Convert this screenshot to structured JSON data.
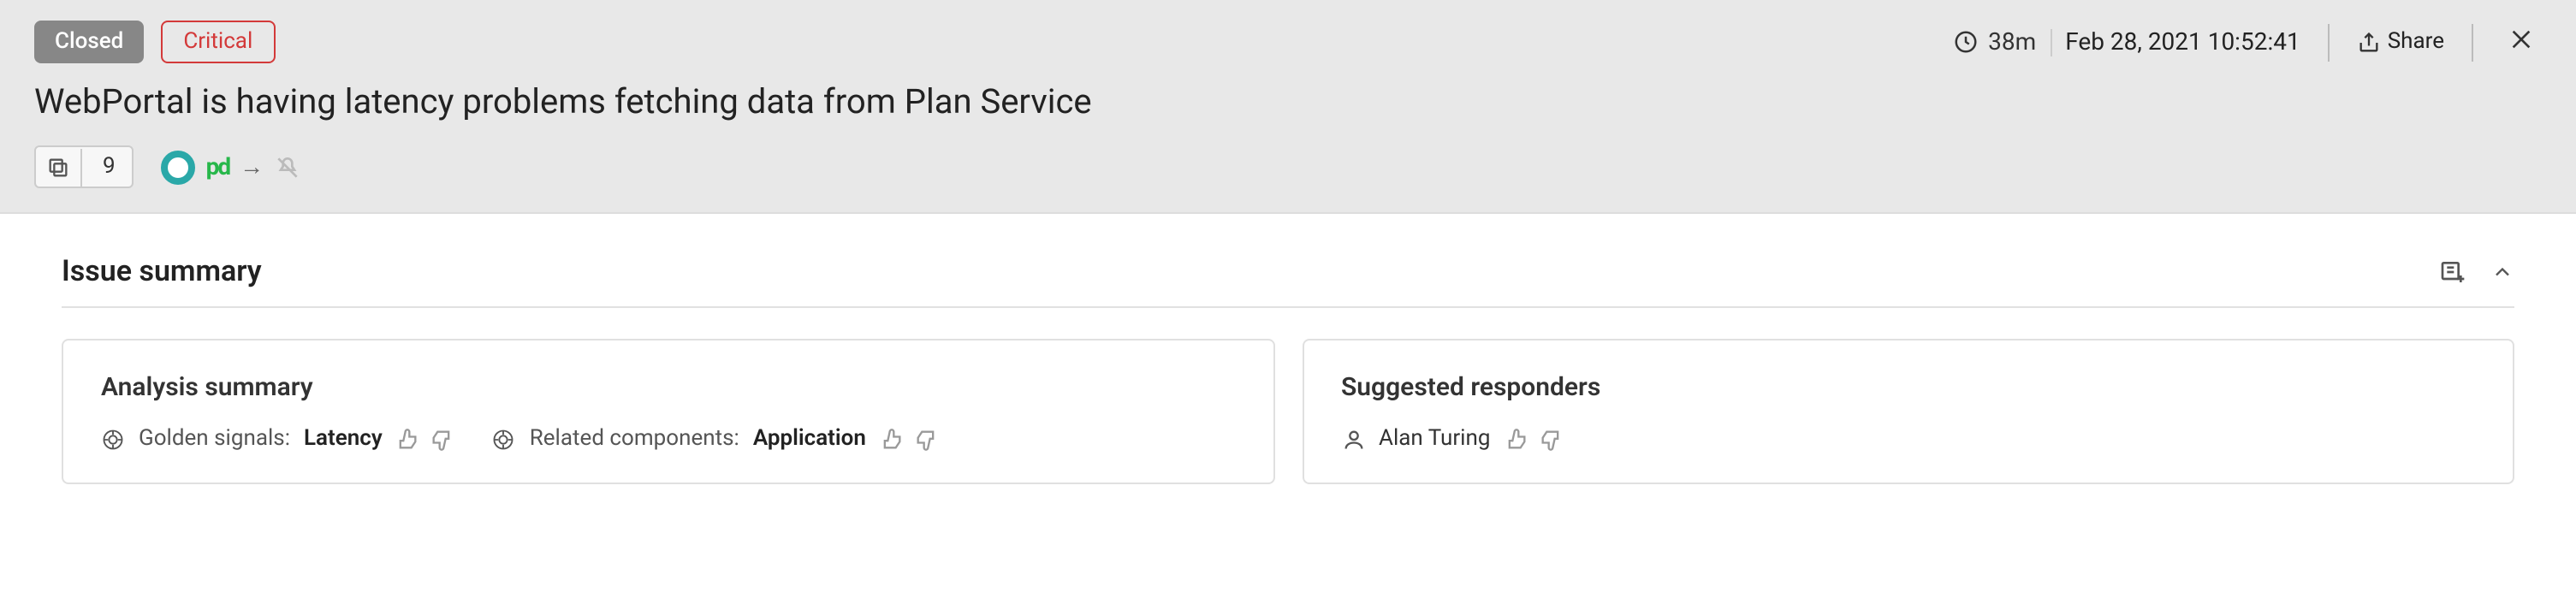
{
  "header": {
    "status_pill": "Closed",
    "severity_pill": "Critical",
    "share_label": "Share",
    "duration": "38m",
    "timestamp": "Feb 28, 2021 10:52:41",
    "title": "WebPortal is having latency problems fetching data from Plan Service",
    "event_count": "9"
  },
  "summary": {
    "section_title": "Issue summary",
    "analysis_card": {
      "title": "Analysis summary",
      "golden_signals_label": "Golden signals:",
      "golden_signals_value": "Latency",
      "related_components_label": "Related components:",
      "related_components_value": "Application"
    },
    "responders_card": {
      "title": "Suggested responders",
      "responder_name": "Alan Turing"
    }
  }
}
